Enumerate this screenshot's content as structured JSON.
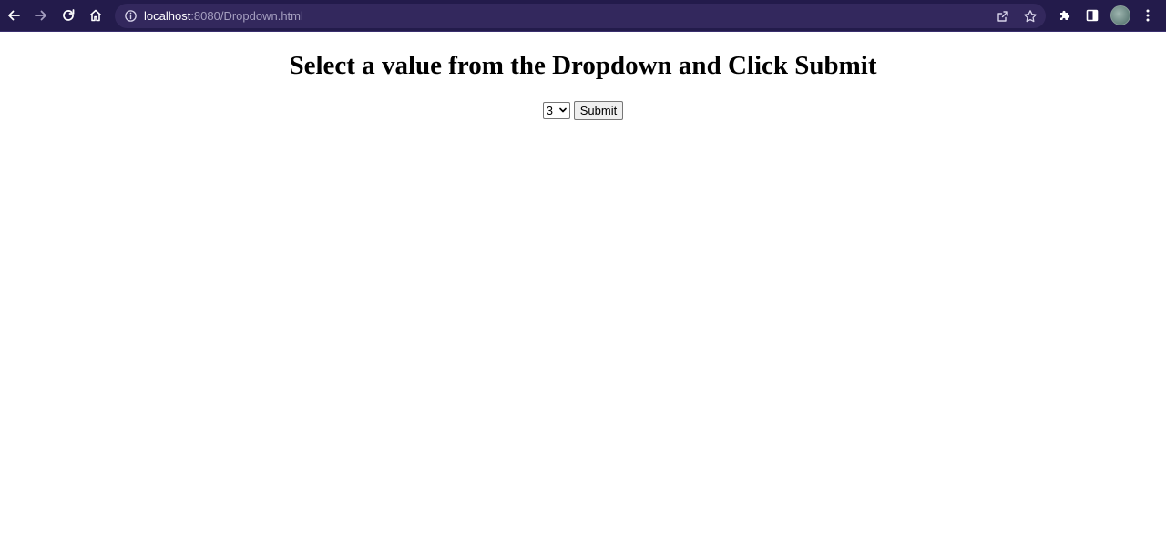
{
  "browser": {
    "url_host": "localhost",
    "url_rest": ":8080/Dropdown.html",
    "icons": {
      "back": "arrow-left-icon",
      "forward": "arrow-right-icon",
      "reload": "reload-icon",
      "home": "home-icon",
      "info": "info-icon",
      "share": "share-icon",
      "bookmark": "star-icon",
      "extensions": "puzzle-icon",
      "sidepanel": "side-panel-icon",
      "profile": "avatar",
      "menu": "kebab-menu-icon"
    },
    "toolbar_color": "#231b4b",
    "omnibox_color": "#33285d"
  },
  "page": {
    "title": "Select a value from the Dropdown and Click Submit",
    "dropdown": {
      "selected": "3"
    },
    "submit_label": "Submit"
  }
}
